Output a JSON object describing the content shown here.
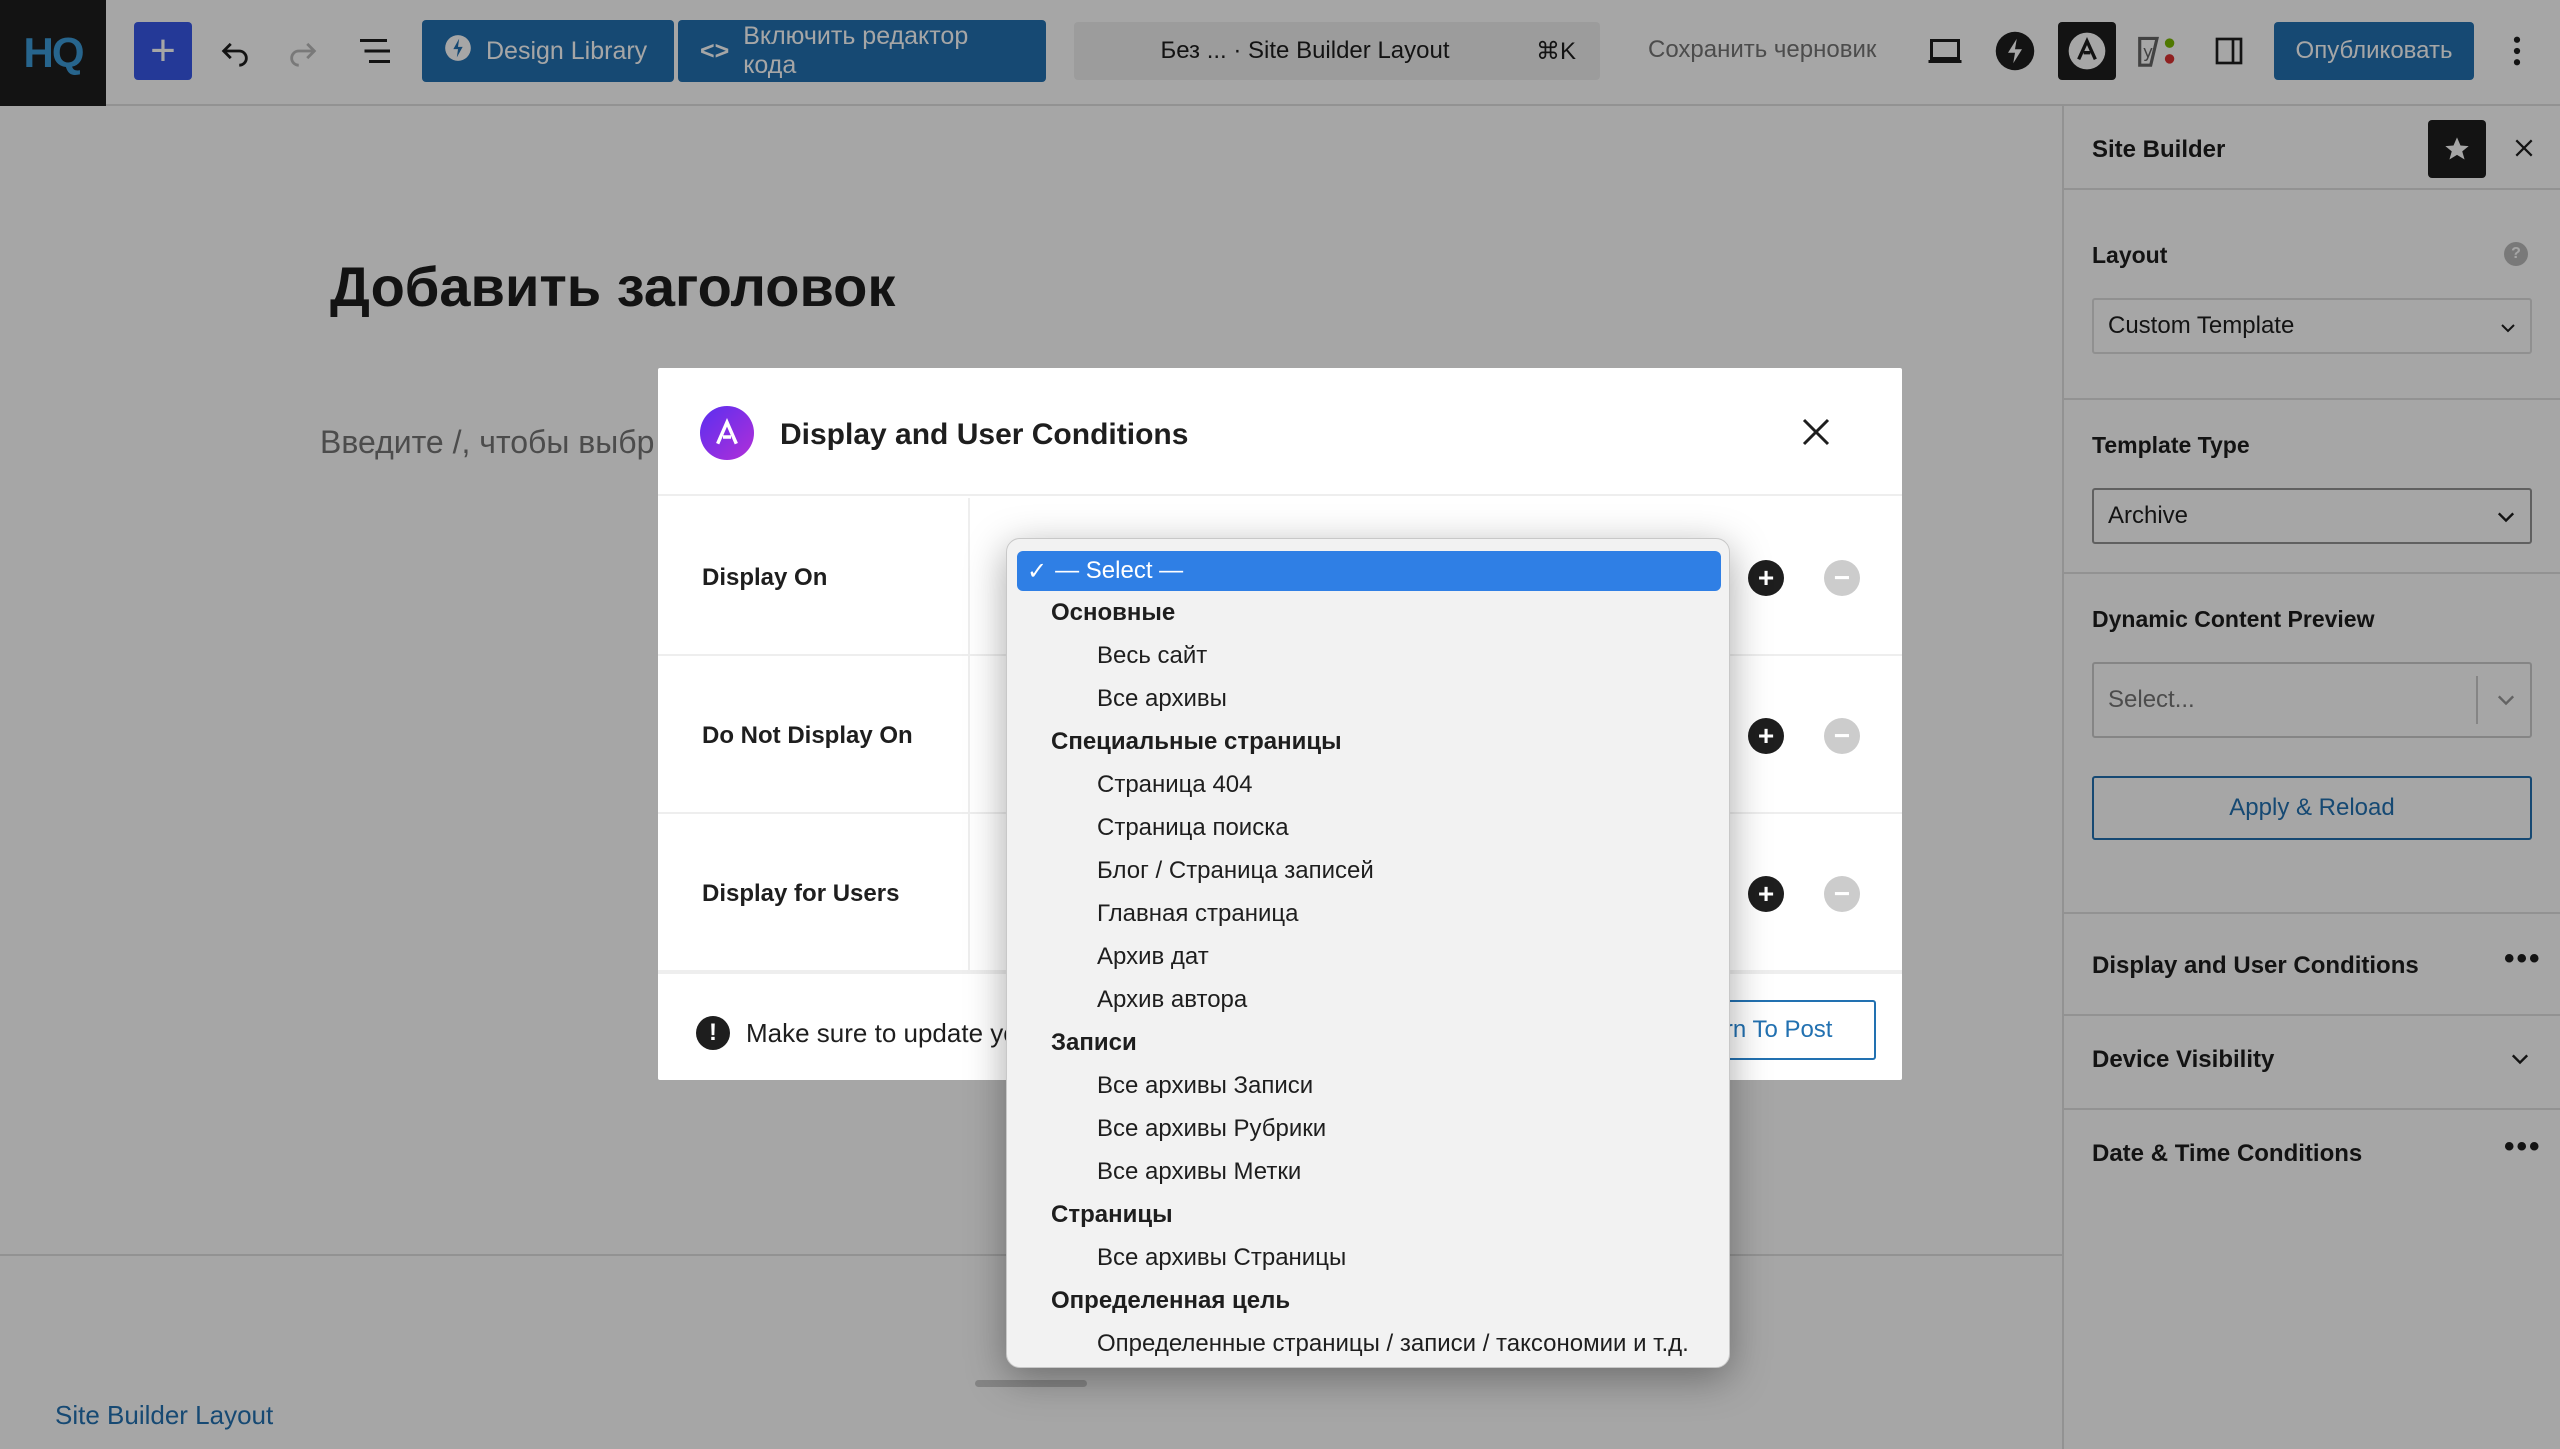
{
  "toolbar": {
    "logo": "HQ",
    "design_library": "Design Library",
    "code_editor": "Включить редактор кода",
    "command_title": "Без ... · Site Builder Layout",
    "command_shortcut": "⌘K",
    "save_draft": "Сохранить черновик",
    "publish": "Опубликовать"
  },
  "editor": {
    "title_placeholder": "Добавить заголовок",
    "block_placeholder": "Введите /, чтобы выбр",
    "breadcrumb": "Site Builder Layout"
  },
  "sidebar": {
    "title": "Site Builder",
    "layout_label": "Layout",
    "layout_value": "Custom Template",
    "template_type_label": "Template Type",
    "template_type_value": "Archive",
    "preview_label": "Dynamic Content Preview",
    "preview_placeholder": "Select...",
    "apply_button": "Apply & Reload",
    "sections": [
      "Display and User Conditions",
      "Device Visibility",
      "Date & Time Conditions"
    ]
  },
  "modal": {
    "title": "Display and User Conditions",
    "rows": [
      "Display On",
      "Do Not Display On",
      "Display for Users"
    ],
    "footer_warning": "Make sure to update yo",
    "return_button": "urn To Post"
  },
  "dropdown": {
    "selected": "— Select —",
    "groups": [
      {
        "label": "Основные",
        "options": [
          "Весь сайт",
          "Все архивы"
        ]
      },
      {
        "label": "Специальные страницы",
        "options": [
          "Страница 404",
          "Страница поиска",
          "Блог / Страница записей",
          "Главная страница",
          "Архив дат",
          "Архив автора"
        ]
      },
      {
        "label": "Записи",
        "options": [
          "Все архивы Записи",
          "Все архивы Рубрики",
          "Все архивы Метки"
        ]
      },
      {
        "label": "Страницы",
        "options": [
          "Все архивы Страницы"
        ]
      },
      {
        "label": "Определенная цель",
        "options": [
          "Определенные страницы / записи / таксономии и т.д."
        ]
      }
    ]
  },
  "colors": {
    "accent": "#2271b1",
    "selection": "#2f7fe5",
    "astra_gradient_start": "#5a2ff0",
    "astra_gradient_end": "#b12fd8"
  }
}
